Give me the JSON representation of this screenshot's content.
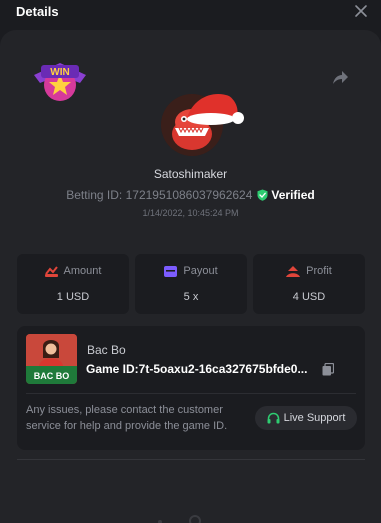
{
  "header": {
    "title": "Details",
    "close_icon": "close-icon"
  },
  "badge": {
    "label": "WIN",
    "icon": "win-badge-icon"
  },
  "share_icon": "share-icon",
  "user": {
    "name": "Satoshimaker",
    "avatar_icon": "dragon-santa-hat-avatar"
  },
  "bet": {
    "id_label": "Betting ID: 1721951086037962624",
    "verified_label": "Verified",
    "timestamp": "1/14/2022, 10:45:24 PM"
  },
  "stats": [
    {
      "label": "Amount",
      "value": "1 USD",
      "icon": "amount-icon"
    },
    {
      "label": "Payout",
      "value": "5 x",
      "icon": "payout-icon"
    },
    {
      "label": "Profit",
      "value": "4 USD",
      "icon": "profit-icon"
    }
  ],
  "game": {
    "name": "Bac Bo",
    "thumb_label": "BAC BO",
    "id_label": "Game ID:7t-5oaxu2-16ca327675bfde0...",
    "copy_icon": "copy-icon"
  },
  "support": {
    "help_text": "Any issues, please contact the customer service for help and provide the game ID.",
    "button_label": "Live Support",
    "icon": "headset-icon"
  },
  "colors": {
    "background": "#1b1c20",
    "card": "#232428",
    "verified": "#2ecc71",
    "accent_red": "#e0453a",
    "payout_purple": "#7c5cff"
  }
}
